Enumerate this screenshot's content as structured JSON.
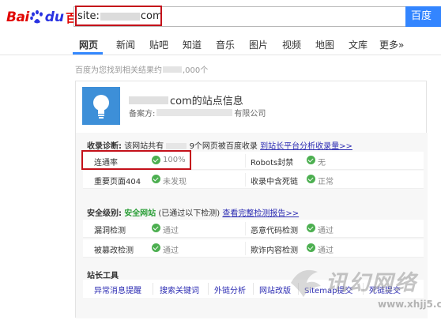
{
  "logo": {
    "bai": "Bai",
    "du": "du",
    "cn": "百度"
  },
  "search": {
    "prefix": "site:",
    "suffix": "com",
    "button": "百度"
  },
  "tabs": [
    {
      "label": "网页",
      "active": true
    },
    {
      "label": "新闻"
    },
    {
      "label": "贴吧"
    },
    {
      "label": "知道"
    },
    {
      "label": "音乐"
    },
    {
      "label": "图片"
    },
    {
      "label": "视频"
    },
    {
      "label": "地图"
    },
    {
      "label": "文库"
    },
    {
      "label": "更多»"
    }
  ],
  "result_count": {
    "prefix": "百度为您找到相关结果约",
    "suffix": ",000个"
  },
  "card": {
    "title_suffix": "com的站点信息",
    "icp_label": "备案方:",
    "icp_suffix": "有限公司",
    "diag": {
      "label": "收录诊断:",
      "text_prefix": "该网站共有",
      "text_suffix": "9个网页被百度收录",
      "link": "到站长平台分析收录量>>"
    },
    "rows1": [
      {
        "label": "连通率",
        "value": "100%",
        "label2": "Robots封禁",
        "value2": "无"
      },
      {
        "label": "重要页面404",
        "value": "未发现",
        "label2": "收录中含死链",
        "value2": "正常"
      }
    ],
    "security": {
      "label": "安全级别:",
      "status": "安全网站",
      "text": "(已通过以下检测)",
      "link": "查看完整检测报告>>"
    },
    "rows2": [
      {
        "label": "漏洞检测",
        "value": "通过",
        "label2": "恶意代码检测",
        "value2": "通过"
      },
      {
        "label": "被篡改检测",
        "value": "通过",
        "label2": "欺诈内容检测",
        "value2": "通过"
      }
    ],
    "tools_title": "站长工具",
    "tools": [
      "异常消息提醒",
      "搜索关键词",
      "外链分析",
      "网站改版",
      "Sitemap提交",
      "死链提交"
    ]
  },
  "watermark": {
    "text": "讯幻网络",
    "url": "www.xhjj5.com"
  },
  "colors": {
    "brand_red": "#e10602",
    "brand_blue": "#2932e1",
    "button_blue": "#3385ff",
    "highlight": "#c4111a",
    "check_green": "#4caf50"
  }
}
